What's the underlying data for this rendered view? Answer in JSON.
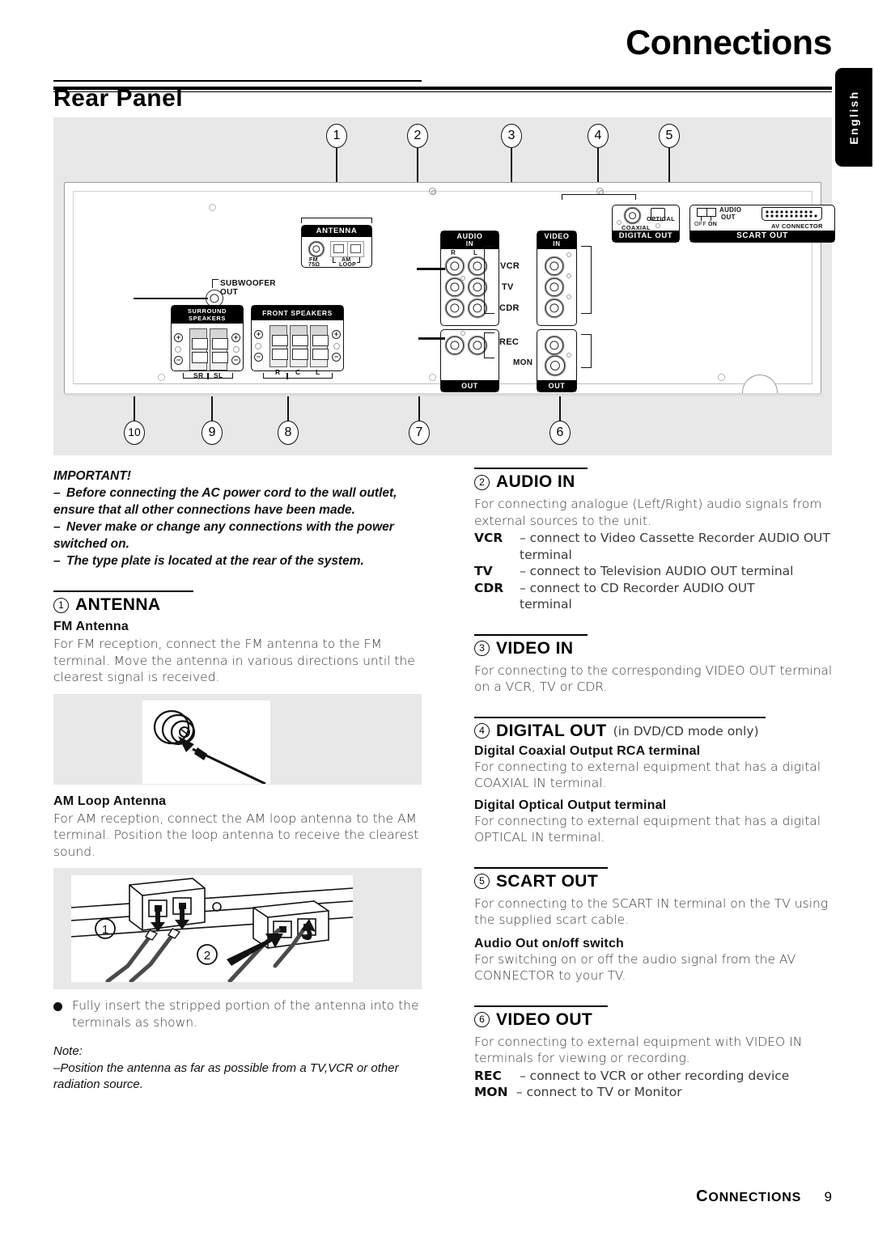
{
  "header": {
    "chapter_title": "Connections",
    "language_tab": "English",
    "section_title": "Rear Panel"
  },
  "diagram": {
    "callouts_top": [
      "1",
      "2",
      "3",
      "4",
      "5"
    ],
    "callouts_bottom": [
      "10",
      "9",
      "8",
      "7",
      "6"
    ],
    "modules": {
      "antenna": {
        "cap": "ANTENNA",
        "fm_label_1": "FM",
        "fm_label_2": "75Ω",
        "am_label_1": "AM",
        "am_label_2": "LOOP"
      },
      "subwoofer": {
        "line1": "SUBWOOFER",
        "line2": "OUT"
      },
      "surround_speakers": {
        "cap_line1": "SURROUND",
        "cap_line2": "SPEAKERS",
        "terminals": [
          "SR",
          "SL"
        ],
        "plus": "+",
        "minus": "−"
      },
      "front_speakers": {
        "cap": "FRONT SPEAKERS",
        "terminals": [
          "R",
          "C",
          "L"
        ]
      },
      "audio_in": {
        "cap_line1": "AUDIO",
        "cap_line2": "IN",
        "col_r": "R",
        "col_l": "L",
        "rows": [
          "VCR",
          "TV",
          "CDR"
        ]
      },
      "video_in": {
        "cap_line1": "VIDEO",
        "cap_line2": "IN"
      },
      "audio_out": {
        "cap": "OUT",
        "rows": [
          "REC"
        ]
      },
      "video_out": {
        "cap": "OUT",
        "rows": [
          "MON"
        ]
      },
      "digital_out": {
        "cap": "DIGITAL OUT",
        "coaxial": "COAXIAL",
        "optical": "OPTICAL"
      },
      "scart_out": {
        "cap": "SCART  OUT",
        "audio_out_line1": "AUDIO",
        "audio_out_line2": "OUT",
        "off": "OFF",
        "on": "ON",
        "av_connector": "AV  CONNECTOR"
      }
    }
  },
  "left_column": {
    "important_title": "IMPORTANT!",
    "important_items": [
      "Before connecting the AC power cord to the wall outlet, ensure that all other connections have been made.",
      "Never make or change any connections with the power switched on.",
      "The type plate is located at the rear of the system."
    ],
    "antenna": {
      "number": "1",
      "title": "ANTENNA",
      "fm_subhead": "FM Antenna",
      "fm_body": "For FM reception, connect the FM antenna to the FM terminal.  Move the antenna in various directions until the clearest signal is received.",
      "am_subhead": "AM Loop Antenna",
      "am_body": "For AM reception, connect the AM loop antenna to the AM terminal.  Position the loop antenna to receive the clearest sound.",
      "fig_am_labels": [
        "1",
        "2"
      ]
    },
    "bullet": "Fully insert the stripped portion of the antenna into the terminals as shown.",
    "note_label": "Note:",
    "note_body": "Position the antenna as far as possible from a TV,VCR or other radiation source."
  },
  "right_column": {
    "audio_in": {
      "number": "2",
      "title": "AUDIO IN",
      "body": "For connecting analogue (Left/Right) audio signals from external sources to the unit.",
      "items": [
        {
          "key": "VCR",
          "value": "– connect to Video Cassette Recorder AUDIO OUT",
          "cont": "terminal"
        },
        {
          "key": "TV",
          "value": "–  connect to Television AUDIO OUT terminal",
          "cont": ""
        },
        {
          "key": "CDR",
          "value": "– connect to CD Recorder AUDIO OUT",
          "cont": "terminal"
        }
      ]
    },
    "video_in": {
      "number": "3",
      "title": "VIDEO IN",
      "body": "For connecting to the corresponding VIDEO OUT terminal on a VCR, TV or CDR."
    },
    "digital_out": {
      "number": "4",
      "title": "DIGITAL OUT",
      "title_sub": "(in DVD/CD mode only)",
      "coax_subhead": "Digital Coaxial Output RCA terminal",
      "coax_body": "For connecting to external equipment that has a digital COAXIAL IN terminal.",
      "optical_subhead": "Digital Optical Output terminal",
      "optical_body": "For connecting to external equipment that has a digital OPTICAL IN terminal."
    },
    "scart_out": {
      "number": "5",
      "title": "SCART OUT",
      "body": "For connecting to the SCART IN terminal on the TV using the supplied scart cable.",
      "switch_subhead": "Audio Out on/off switch",
      "switch_body": "For switching on or off the audio signal from the AV CONNECTOR to your TV."
    },
    "video_out": {
      "number": "6",
      "title": "VIDEO OUT",
      "body": "For connecting to external equipment with VIDEO IN terminals for viewing or recording.",
      "items": [
        {
          "key": "REC",
          "value": "–  connect to VCR or other recording device"
        },
        {
          "key": "MON",
          "value": "–  connect to TV or Monitor"
        }
      ]
    }
  },
  "footer": {
    "name_first": "C",
    "name_rest": "ONNECTIONS",
    "page": "9"
  }
}
